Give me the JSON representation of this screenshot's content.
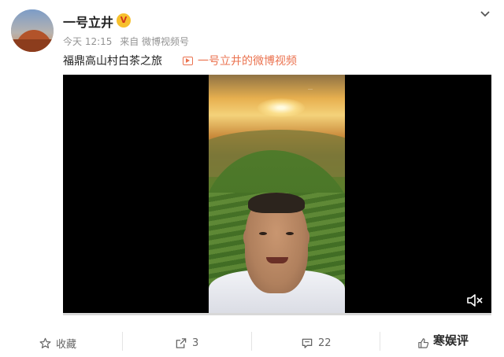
{
  "post": {
    "username": "一号立井",
    "vip_badge": "V",
    "time": "今天 12:15",
    "source": "来自 微博视频号",
    "text": "福鼎高山村白茶之旅",
    "video_link": "一号立井的微博视频"
  },
  "video": {
    "watermark": "…",
    "muted": true,
    "progress": 0.0
  },
  "actions": {
    "favorite_label": "收藏",
    "repost_count": "3",
    "comment_count": "22",
    "like_count": ""
  },
  "site": {
    "watermark_text": "寒娱评"
  },
  "colors": {
    "link": "#eb7350",
    "accent": "#ff8200"
  },
  "icons": [
    "chevron-down-icon",
    "video-icon",
    "mute-icon",
    "star-icon",
    "repost-icon",
    "comment-icon",
    "like-icon"
  ]
}
